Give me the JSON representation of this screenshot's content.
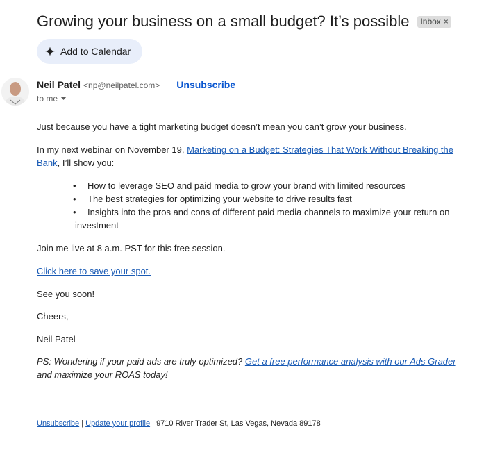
{
  "email": {
    "subject": "Growing your business on a small budget? It’s possible",
    "label_chip": "Inbox",
    "label_close": "×",
    "add_to_calendar": "Add to Calendar",
    "sender_name": "Neil Patel",
    "sender_email": "<np@neilpatel.com>",
    "unsubscribe_top": "Unsubscribe",
    "recipient": "to me"
  },
  "body": {
    "p1": "Just because you have a tight marketing budget doesn’t mean you can’t grow your business.",
    "p2_prefix": "In my next webinar on November 19, ",
    "p2_link": "Marketing on a Budget: Strategies That Work Without Breaking the Bank",
    "p2_suffix": ", I’ll show you:",
    "bullets": [
      "How to leverage SEO and paid media to grow your brand with limited resources",
      "The best strategies for optimizing your website to drive results fast",
      "Insights into the pros and cons of different paid media channels to maximize your return on",
      "investment"
    ],
    "p3": "Join me live at 8 a.m. PST for this free session.",
    "cta_link": "Click here to save your spot. ",
    "p4": "See you soon!",
    "p5": "Cheers,",
    "p6": "Neil Patel",
    "ps_prefix": "PS: Wondering if your paid ads are truly optimized? ",
    "ps_link": "Get a free performance analysis with our Ads Grader",
    "ps_suffix": " and maximize your ROAS today!"
  },
  "footer": {
    "unsubscribe": "Unsubscribe",
    "sep1": " | ",
    "update_profile": "Update your profile",
    "sep2": " | ",
    "address": "9710 River Trader St, Las Vegas, Nevada 89178"
  },
  "icons": {
    "sparkle": "sparkle-icon",
    "dropdown": "chevron-down-icon"
  },
  "colors": {
    "link": "#1a5bb5",
    "unsubscribe_top": "#0b57d0",
    "calendar_button_bg": "#e8eefa",
    "label_chip_bg": "#dddddd"
  }
}
